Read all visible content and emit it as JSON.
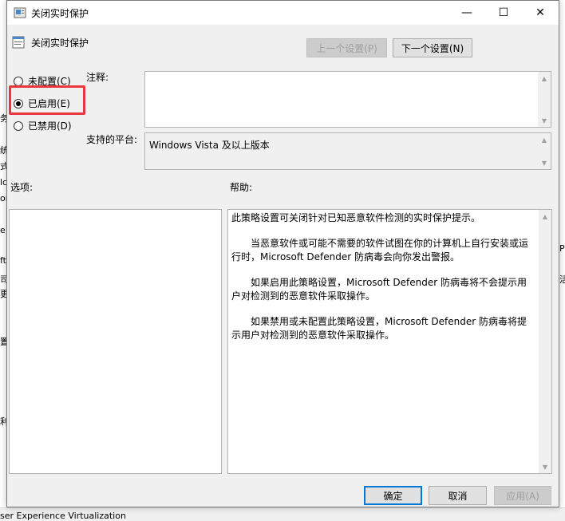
{
  "background": {
    "left_fragments": [
      "务",
      "统",
      "式",
      "lc",
      "or",
      "e",
      "ft",
      "司",
      "更",
      "置",
      "利"
    ],
    "right_fragments": [
      "P",
      "活"
    ],
    "bottom_text": "ser Experience Virtualization"
  },
  "window": {
    "title": "关闭实时保护",
    "minimize": "—",
    "maximize": "☐",
    "close": "✕"
  },
  "header": {
    "policy_name": "关闭实时保护"
  },
  "nav": {
    "prev_label": "上一个设置(P)",
    "next_label": "下一个设置(N)"
  },
  "options_radio": {
    "not_configured": "未配置(C)",
    "enabled": "已启用(E)",
    "disabled": "已禁用(D)",
    "selected": "enabled"
  },
  "comment": {
    "label": "注释:",
    "value": ""
  },
  "platform": {
    "label": "支持的平台:",
    "value": "Windows Vista 及以上版本"
  },
  "options_section": {
    "label": "选项:"
  },
  "help_section": {
    "label": "帮助:",
    "paragraphs": [
      "此策略设置可关闭针对已知恶意软件检测的实时保护提示。",
      "当恶意软件或可能不需要的软件试图在你的计算机上自行安装或运行时，Microsoft Defender 防病毒会向你发出警报。",
      "如果启用此策略设置，Microsoft Defender 防病毒将不会提示用户对检测到的恶意软件采取操作。",
      "如果禁用或未配置此策略设置，Microsoft Defender 防病毒将提示用户对检测到的恶意软件采取操作。"
    ]
  },
  "footer": {
    "ok_label": "确定",
    "cancel_label": "取消",
    "apply_label": "应用(A)"
  },
  "colors": {
    "highlight": "#e8383d",
    "primary_border": "#0078d7"
  }
}
